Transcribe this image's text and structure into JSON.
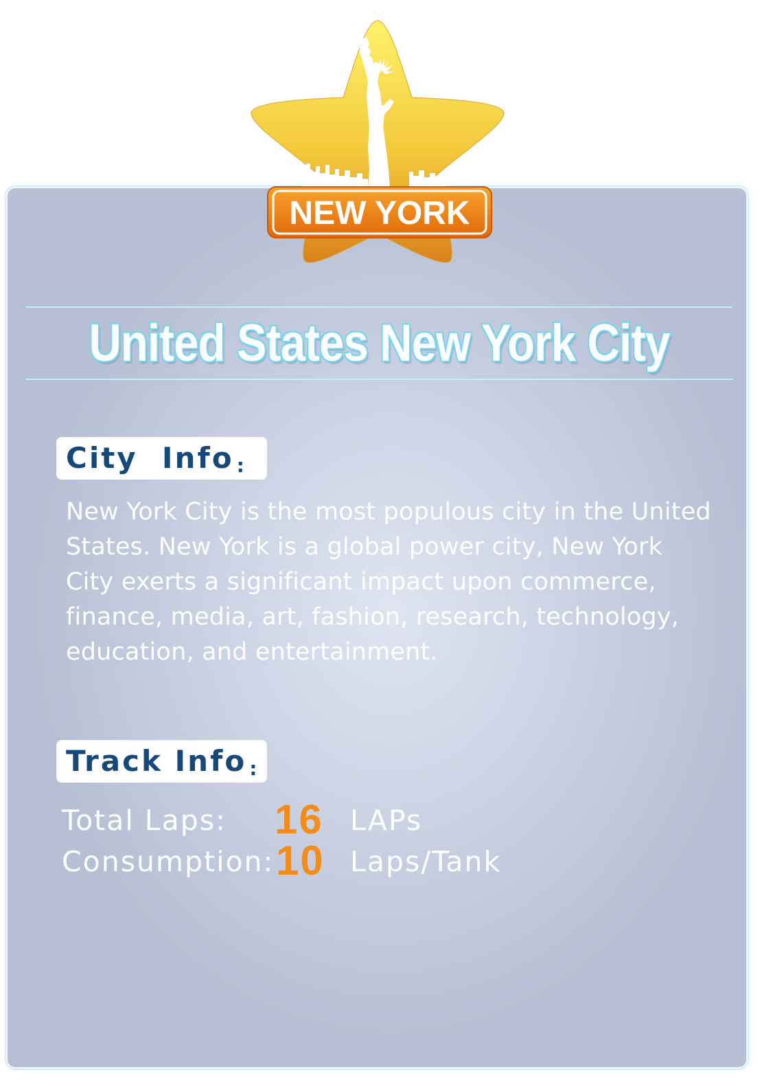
{
  "emblem": {
    "banner_text": "NEW YORK",
    "icon": "statue-of-liberty-icon",
    "colors": {
      "star_top": "#fce95a",
      "star_bottom": "#d9871e",
      "banner": "#f28a1a"
    }
  },
  "title": "United States New York City",
  "city_info": {
    "label": "City  Info",
    "colon": ":",
    "description": "New York City is the most populous city in the United States. New York is a global power city, New York City exerts a significant impact upon commerce, finance, media, art, fashion, research, technology, education, and entertainment."
  },
  "track_info": {
    "label": "Track Info",
    "colon": ":",
    "total_laps": {
      "label": "Total  Laps:",
      "value": "16",
      "unit": "LAPs"
    },
    "consumption": {
      "label": "Consumption:",
      "value": "10",
      "unit": "Laps/Tank"
    }
  },
  "colors": {
    "accent": "#f38d1a",
    "label_text": "#16497a",
    "title_outline": "#74d6ee"
  }
}
